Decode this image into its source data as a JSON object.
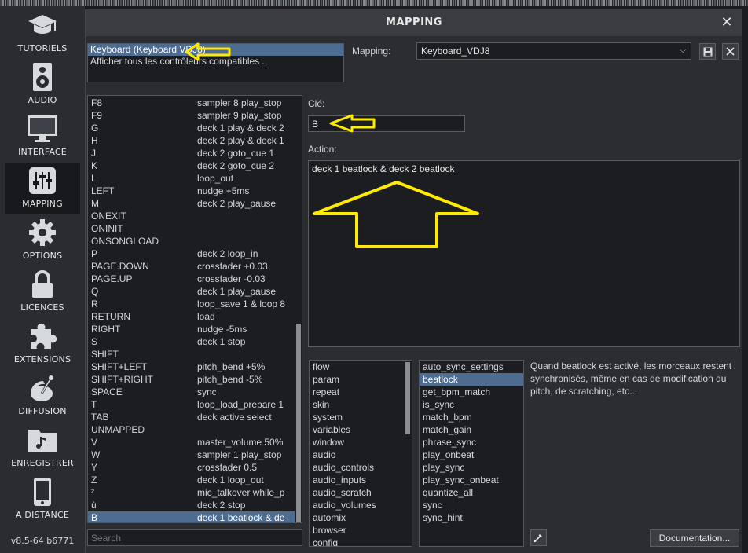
{
  "sidebar": {
    "items": [
      {
        "label": "TUTORIELS",
        "icon": "graduation-cap-icon"
      },
      {
        "label": "AUDIO",
        "icon": "speaker-icon"
      },
      {
        "label": "INTERFACE",
        "icon": "monitor-icon"
      },
      {
        "label": "MAPPING",
        "icon": "sliders-icon",
        "active": true
      },
      {
        "label": "OPTIONS",
        "icon": "gear-icon"
      },
      {
        "label": "LICENCES",
        "icon": "lock-icon"
      },
      {
        "label": "EXTENSIONS",
        "icon": "puzzle-icon"
      },
      {
        "label": "DIFFUSION",
        "icon": "broadcast-icon"
      },
      {
        "label": "ENREGISTRER",
        "icon": "music-folder-icon"
      },
      {
        "label": "A DISTANCE",
        "icon": "phone-icon"
      }
    ],
    "version": "v8.5-64 b6771"
  },
  "dialog": {
    "title": "MAPPING",
    "close_label": "✕"
  },
  "controllers": [
    {
      "label": "Keyboard (Keyboard VDJ8)",
      "selected": true
    },
    {
      "label": "Afficher tous les contrôleurs compatibles ..",
      "selected": false
    }
  ],
  "mapping": {
    "label": "Mapping:",
    "value": "Keyboard_VDJ8"
  },
  "keys": [
    {
      "key": "F8",
      "action": "sampler 8 play_stop"
    },
    {
      "key": "F9",
      "action": "sampler 9 play_stop"
    },
    {
      "key": "G",
      "action": "deck 1 play & deck 2"
    },
    {
      "key": "H",
      "action": "deck 2 play & deck 1"
    },
    {
      "key": "J",
      "action": "deck 2 goto_cue 1"
    },
    {
      "key": "K",
      "action": "deck 2 goto_cue 2"
    },
    {
      "key": "L",
      "action": "loop_out"
    },
    {
      "key": "LEFT",
      "action": "nudge +5ms"
    },
    {
      "key": "M",
      "action": "deck 2 play_pause"
    },
    {
      "key": "ONEXIT",
      "action": ""
    },
    {
      "key": "ONINIT",
      "action": ""
    },
    {
      "key": "ONSONGLOAD",
      "action": ""
    },
    {
      "key": "P",
      "action": "deck 2 loop_in"
    },
    {
      "key": "PAGE.DOWN",
      "action": "crossfader +0.03"
    },
    {
      "key": "PAGE.UP",
      "action": "crossfader -0.03"
    },
    {
      "key": "Q",
      "action": "deck 1 play_pause"
    },
    {
      "key": "R",
      "action": "loop_save 1 & loop 8"
    },
    {
      "key": "RETURN",
      "action": "load"
    },
    {
      "key": "RIGHT",
      "action": "nudge -5ms"
    },
    {
      "key": "S",
      "action": "deck 1 stop"
    },
    {
      "key": "SHIFT",
      "action": ""
    },
    {
      "key": "SHIFT+LEFT",
      "action": "pitch_bend +5%"
    },
    {
      "key": "SHIFT+RIGHT",
      "action": "pitch_bend -5%"
    },
    {
      "key": "SPACE",
      "action": "sync"
    },
    {
      "key": "T",
      "action": "loop_load_prepare 1"
    },
    {
      "key": "TAB",
      "action": "deck active select"
    },
    {
      "key": "UNMAPPED",
      "action": ""
    },
    {
      "key": "V",
      "action": "master_volume 50%"
    },
    {
      "key": "W",
      "action": "sampler 1 play_stop"
    },
    {
      "key": "Y",
      "action": "crossfader 0.5"
    },
    {
      "key": "Z",
      "action": "deck 1 loop_out"
    },
    {
      "key": "²",
      "action": "mic_talkover while_p"
    },
    {
      "key": "ù",
      "action": "deck 2 stop"
    },
    {
      "key": "B",
      "action": "deck 1 beatlock & de",
      "selected": true
    }
  ],
  "search": {
    "placeholder": "Search"
  },
  "editor": {
    "key_label": "Clé:",
    "key_value": "B",
    "action_label": "Action:",
    "action_value": "deck 1 beatlock & deck 2 beatlock"
  },
  "categories": [
    "flow",
    "param",
    "repeat",
    "skin",
    "system",
    "variables",
    "window",
    "audio",
    "audio_controls",
    "audio_inputs",
    "audio_scratch",
    "audio_volumes",
    "automix",
    "browser",
    "config"
  ],
  "verbs": [
    {
      "label": "auto_sync_settings"
    },
    {
      "label": "beatlock",
      "selected": true
    },
    {
      "label": "get_bpm_match"
    },
    {
      "label": "is_sync"
    },
    {
      "label": "match_bpm"
    },
    {
      "label": "match_gain"
    },
    {
      "label": "phrase_sync"
    },
    {
      "label": "play_onbeat"
    },
    {
      "label": "play_sync"
    },
    {
      "label": "play_sync_onbeat"
    },
    {
      "label": "quantize_all"
    },
    {
      "label": "sync"
    },
    {
      "label": "sync_hint"
    }
  ],
  "description": "Quand beatlock est activé, les morceaux restent synchronisés, même en cas de modification du pitch, de scratching, etc...",
  "documentation_label": "Documentation...",
  "colors": {
    "selection": "#4d6c8f",
    "annotation": "#ffea00"
  }
}
